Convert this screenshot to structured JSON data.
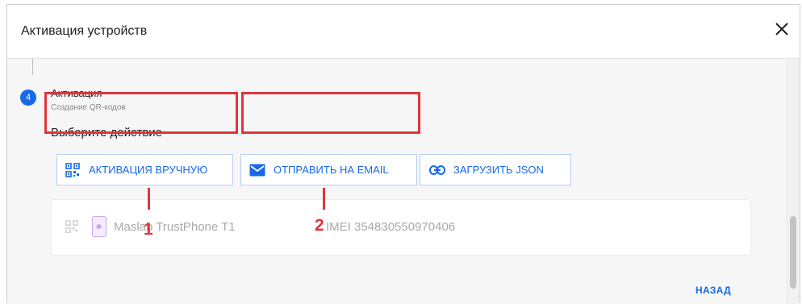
{
  "dialog": {
    "title": "Активация устройств"
  },
  "step": {
    "number": "4",
    "title": "Активация",
    "subtitle": "Создание QR-кодов"
  },
  "actions": {
    "prompt": "Выберите действие",
    "manual_label": "АКТИВАЦИЯ ВРУЧНУЮ",
    "email_label": "ОТПРАВИТЬ НА EMAIL",
    "json_label": "ЗАГРУЗИТЬ JSON"
  },
  "device": {
    "name": "Maslab TrustPhone T1",
    "imei": "IMEI 354830550970406"
  },
  "annotations": {
    "callout_1": "1",
    "callout_2": "2"
  },
  "footer": {
    "back_label": "НАЗАД"
  },
  "colors": {
    "accent": "#1769e8",
    "annotation_red": "#e0343a",
    "body_bg": "#f6f6f7"
  },
  "icons": {
    "close": "close-icon",
    "manual": "qr-code-icon",
    "email": "envelope-icon",
    "json": "link-icon",
    "device": "smartphone-icon"
  }
}
